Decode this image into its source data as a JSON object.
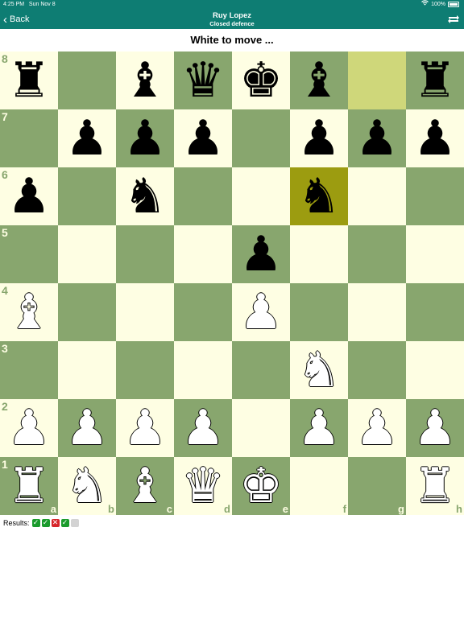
{
  "status_bar": {
    "time": "4:25 PM",
    "date": "Sun Nov 8",
    "battery": "100%"
  },
  "nav": {
    "back_label": "Back",
    "title": "Ruy Lopez",
    "subtitle": "Closed defence",
    "flip_icon": "flip-board-icon"
  },
  "prompt": "White to move ...",
  "board": {
    "files": [
      "a",
      "b",
      "c",
      "d",
      "e",
      "f",
      "g",
      "h"
    ],
    "ranks": [
      "8",
      "7",
      "6",
      "5",
      "4",
      "3",
      "2",
      "1"
    ],
    "light_color": "#fefee3",
    "dark_color": "#88a66e",
    "highlight_from": "g8",
    "highlight_to": "f6",
    "highlight_from_color": "#cfd77a",
    "highlight_to_color": "#9c9c10",
    "pieces": [
      {
        "square": "a8",
        "piece": "rook",
        "color": "black",
        "glyph": "♜"
      },
      {
        "square": "c8",
        "piece": "bishop",
        "color": "black",
        "glyph": "♝"
      },
      {
        "square": "d8",
        "piece": "queen",
        "color": "black",
        "glyph": "♛"
      },
      {
        "square": "e8",
        "piece": "king",
        "color": "black",
        "glyph": "♚"
      },
      {
        "square": "f8",
        "piece": "bishop",
        "color": "black",
        "glyph": "♝"
      },
      {
        "square": "h8",
        "piece": "rook",
        "color": "black",
        "glyph": "♜"
      },
      {
        "square": "b7",
        "piece": "pawn",
        "color": "black",
        "glyph": "♟"
      },
      {
        "square": "c7",
        "piece": "pawn",
        "color": "black",
        "glyph": "♟"
      },
      {
        "square": "d7",
        "piece": "pawn",
        "color": "black",
        "glyph": "♟"
      },
      {
        "square": "f7",
        "piece": "pawn",
        "color": "black",
        "glyph": "♟"
      },
      {
        "square": "g7",
        "piece": "pawn",
        "color": "black",
        "glyph": "♟"
      },
      {
        "square": "h7",
        "piece": "pawn",
        "color": "black",
        "glyph": "♟"
      },
      {
        "square": "a6",
        "piece": "pawn",
        "color": "black",
        "glyph": "♟"
      },
      {
        "square": "c6",
        "piece": "knight",
        "color": "black",
        "glyph": "♞"
      },
      {
        "square": "f6",
        "piece": "knight",
        "color": "black",
        "glyph": "♞"
      },
      {
        "square": "e5",
        "piece": "pawn",
        "color": "black",
        "glyph": "♟"
      },
      {
        "square": "a4",
        "piece": "bishop",
        "color": "white",
        "glyph": "♝"
      },
      {
        "square": "e4",
        "piece": "pawn",
        "color": "white",
        "glyph": "♟"
      },
      {
        "square": "f3",
        "piece": "knight",
        "color": "white",
        "glyph": "♞"
      },
      {
        "square": "a2",
        "piece": "pawn",
        "color": "white",
        "glyph": "♟"
      },
      {
        "square": "b2",
        "piece": "pawn",
        "color": "white",
        "glyph": "♟"
      },
      {
        "square": "c2",
        "piece": "pawn",
        "color": "white",
        "glyph": "♟"
      },
      {
        "square": "d2",
        "piece": "pawn",
        "color": "white",
        "glyph": "♟"
      },
      {
        "square": "f2",
        "piece": "pawn",
        "color": "white",
        "glyph": "♟"
      },
      {
        "square": "g2",
        "piece": "pawn",
        "color": "white",
        "glyph": "♟"
      },
      {
        "square": "h2",
        "piece": "pawn",
        "color": "white",
        "glyph": "♟"
      },
      {
        "square": "a1",
        "piece": "rook",
        "color": "white",
        "glyph": "♜"
      },
      {
        "square": "b1",
        "piece": "knight",
        "color": "white",
        "glyph": "♞"
      },
      {
        "square": "c1",
        "piece": "bishop",
        "color": "white",
        "glyph": "♝"
      },
      {
        "square": "d1",
        "piece": "queen",
        "color": "white",
        "glyph": "♛"
      },
      {
        "square": "e1",
        "piece": "king",
        "color": "white",
        "glyph": "♚"
      },
      {
        "square": "h1",
        "piece": "rook",
        "color": "white",
        "glyph": "♜"
      }
    ]
  },
  "results": {
    "label": "Results:",
    "items": [
      "correct",
      "correct",
      "wrong",
      "correct",
      "pending"
    ],
    "correct_color": "#1a9b2c",
    "wrong_color": "#d6252a",
    "pending_color": "#d3d3d3"
  }
}
